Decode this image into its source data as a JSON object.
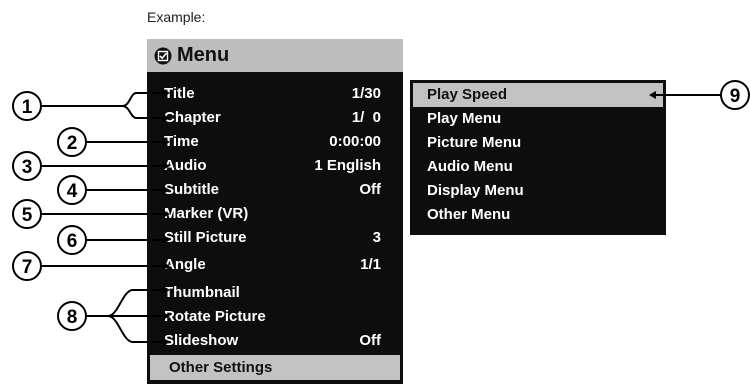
{
  "caption": "Example:",
  "menu": {
    "title": "Menu",
    "rows": [
      {
        "label": "Title",
        "value": "1/30"
      },
      {
        "label": "Chapter",
        "value": "1/  0"
      },
      {
        "label": "Time",
        "value": "0:00:00"
      },
      {
        "label": "Audio",
        "value": "1 English"
      },
      {
        "label": "Subtitle",
        "value": "Off"
      },
      {
        "label": "Marker (VR)",
        "value": ""
      },
      {
        "label": "Still Picture",
        "value": "3"
      },
      {
        "label": "Angle",
        "value": "1/1"
      },
      {
        "label": "Thumbnail",
        "value": ""
      },
      {
        "label": "Rotate Picture",
        "value": ""
      },
      {
        "label": "Slideshow",
        "value": "Off"
      }
    ],
    "footer": "Other Settings"
  },
  "submenu": {
    "items": [
      "Play Speed",
      "Play Menu",
      "Picture Menu",
      "Audio Menu",
      "Display Menu",
      "Other Menu"
    ],
    "selected_index": 0
  },
  "callouts": [
    "1",
    "2",
    "3",
    "4",
    "5",
    "6",
    "7",
    "8",
    "9"
  ],
  "colors": {
    "panel": "#0d0d0d",
    "highlight": "#c2c2c2",
    "header": "#bdbdbd"
  }
}
